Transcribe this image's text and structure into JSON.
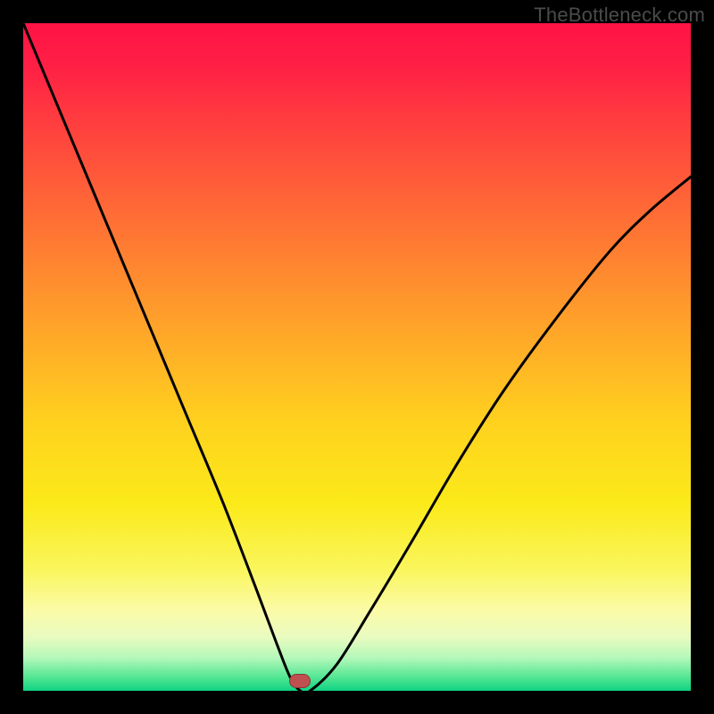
{
  "watermark": "TheBottleneck.com",
  "marker": {
    "x_frac": 0.415,
    "y_frac": 0.985
  },
  "chart_data": {
    "type": "line",
    "title": "",
    "xlabel": "",
    "ylabel": "",
    "xlim": [
      0,
      1
    ],
    "ylim": [
      0,
      1
    ],
    "series": [
      {
        "name": "bottleneck-curve",
        "x": [
          0.0,
          0.05,
          0.1,
          0.15,
          0.2,
          0.25,
          0.3,
          0.35,
          0.38,
          0.4,
          0.415,
          0.43,
          0.47,
          0.52,
          0.58,
          0.65,
          0.72,
          0.8,
          0.88,
          0.94,
          1.0
        ],
        "y": [
          1.0,
          0.88,
          0.76,
          0.64,
          0.52,
          0.4,
          0.28,
          0.15,
          0.07,
          0.02,
          0.0,
          0.0,
          0.04,
          0.12,
          0.22,
          0.34,
          0.45,
          0.56,
          0.66,
          0.72,
          0.77
        ]
      }
    ],
    "annotations": [
      {
        "text": "min-marker",
        "x": 0.415,
        "y": 0.0
      }
    ]
  }
}
